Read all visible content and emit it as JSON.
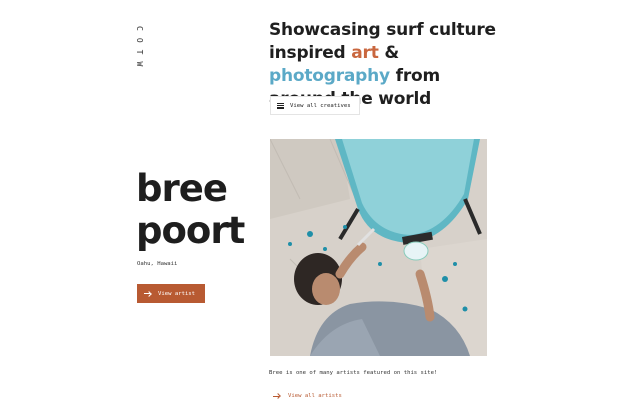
{
  "brand": {
    "vertical_logo": "COTW"
  },
  "hero": {
    "headline_part1": "Showcasing surf culture inspired ",
    "headline_art": "art",
    "headline_amp": " & ",
    "headline_photo": "photography",
    "headline_part2": " from around the world",
    "view_creatives_label": "View all creatives",
    "colors": {
      "art": "#c9673f",
      "photography": "#5ba9c7"
    }
  },
  "artist": {
    "first_name": "bree",
    "last_name": "poort",
    "location": "Oahu, Hawaii",
    "view_artist_label": "View artist",
    "button_color": "#b85a32"
  },
  "feature": {
    "photo_alt": "Artist painting a surfboard blue",
    "caption": "Bree is one of many artists featured on this site!",
    "view_all_artists_label": "View all artists"
  }
}
